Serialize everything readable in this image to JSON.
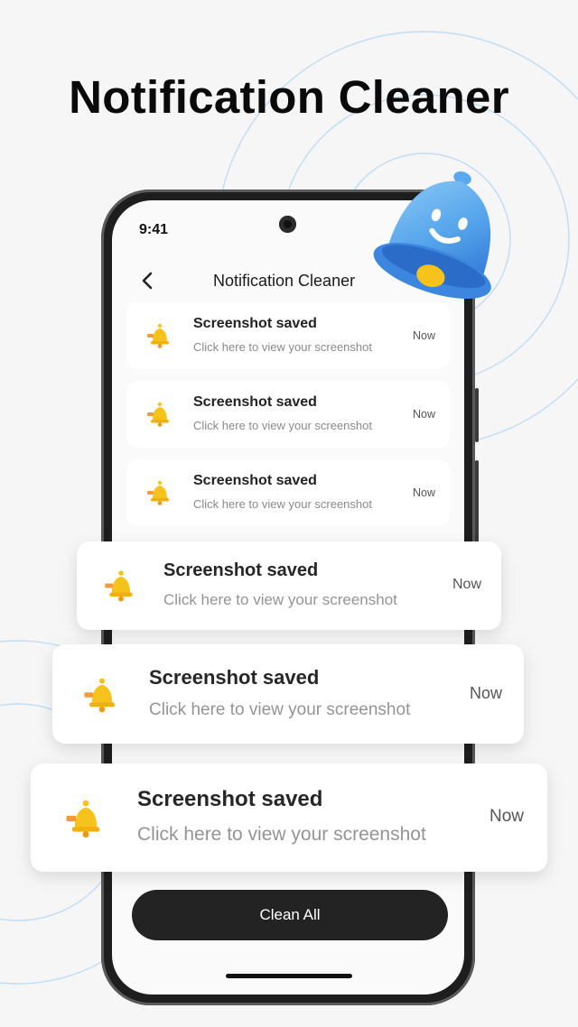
{
  "hero": {
    "title": "Notification Cleaner"
  },
  "status_bar": {
    "time": "9:41"
  },
  "app": {
    "title": "Notification Cleaner",
    "clean_button": "Clean All"
  },
  "notifications": [
    {
      "title": "Screenshot saved",
      "subtitle": "Click here to view your screenshot",
      "time": "Now"
    },
    {
      "title": "Screenshot saved",
      "subtitle": "Click here to view your screenshot",
      "time": "Now"
    },
    {
      "title": "Screenshot saved",
      "subtitle": "Click here to view your screenshot",
      "time": "Now"
    }
  ],
  "floating_notifications": [
    {
      "title": "Screenshot saved",
      "subtitle": "Click here to view your screenshot",
      "time": "Now"
    },
    {
      "title": "Screenshot saved",
      "subtitle": "Click here to view your screenshot",
      "time": "Now"
    },
    {
      "title": "Screenshot saved",
      "subtitle": "Click here to view your screenshot",
      "time": "Now"
    }
  ],
  "icons": {
    "back": "chevron-left-icon",
    "notification": "bell-icon",
    "mascot": "smiling-bell-icon"
  },
  "colors": {
    "accent_blue": "#5aa9ee",
    "bell_yellow": "#f6c21c",
    "button_dark": "#232323"
  }
}
